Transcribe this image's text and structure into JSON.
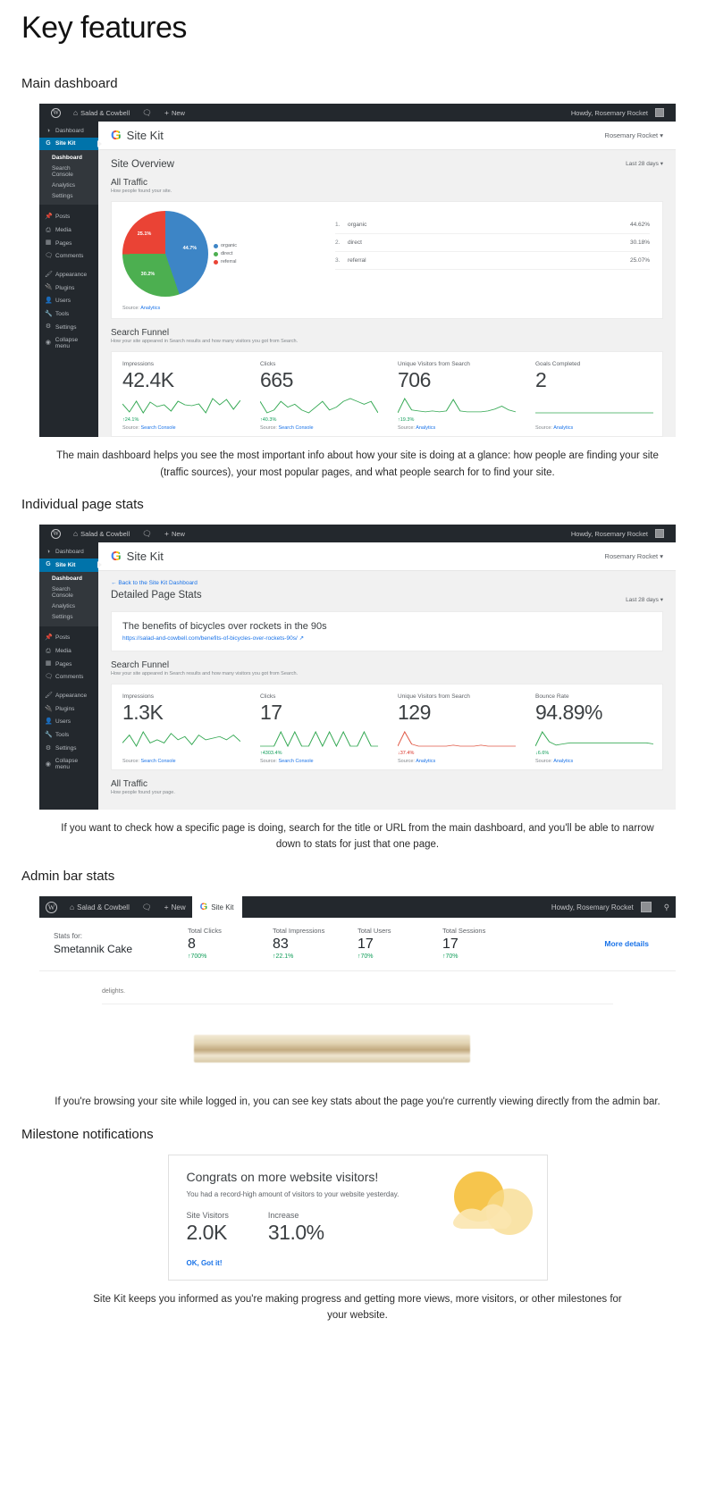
{
  "page": {
    "title": "Key features"
  },
  "sections": [
    {
      "heading": "Main dashboard"
    },
    {
      "heading": "Individual page stats"
    },
    {
      "heading": "Admin bar stats"
    },
    {
      "heading": "Milestone notifications"
    }
  ],
  "captions": {
    "main_dashboard": "The main dashboard helps you see the most important info about how your site is doing at a glance: how people are finding your site (traffic sources), your most popular pages, and what people search for to find your site.",
    "page_stats": "If you want to check how a specific page is doing, search for the title or URL from the main dashboard, and you'll be able to narrow down to stats for just that one page.",
    "admin_bar": "If you're browsing your site while logged in, you can see key stats about the page you're currently viewing directly from the admin bar.",
    "milestone": "Site Kit keeps you informed as you're making progress and getting more views, more visitors, or other milestones for your website."
  },
  "adminbar": {
    "wp_logo": "wordpress-logo-icon",
    "site_name": "Salad & Cowbell",
    "comments_icon": "comments-icon",
    "new_label": "New",
    "howdy": "Howdy, Rosemary Rocket",
    "avatar": "avatar",
    "sitekit_tab": "Site Kit",
    "search_icon": "search-icon"
  },
  "wp_menu": {
    "dashboard": "Dashboard",
    "site_kit": "Site Kit",
    "sitekit_submenu": [
      "Dashboard",
      "Search Console",
      "Analytics",
      "Settings"
    ],
    "items": [
      {
        "label": "Posts",
        "icon": "pin-icon"
      },
      {
        "label": "Media",
        "icon": "media-icon"
      },
      {
        "label": "Pages",
        "icon": "page-icon"
      },
      {
        "label": "Comments",
        "icon": "comment-icon"
      }
    ],
    "items2": [
      {
        "label": "Appearance",
        "icon": "brush-icon"
      },
      {
        "label": "Plugins",
        "icon": "plugin-icon"
      },
      {
        "label": "Users",
        "icon": "users-icon"
      },
      {
        "label": "Tools",
        "icon": "tools-icon"
      },
      {
        "label": "Settings",
        "icon": "settings-icon"
      }
    ],
    "collapse": "Collapse menu"
  },
  "sitekit": {
    "brand": "Site Kit",
    "g_logo": "google-g-icon",
    "user": "Rosemary Rocket",
    "user_chevron": "chevron-down-icon"
  },
  "dashboard": {
    "overview_title": "Site Overview",
    "date_range": "Last 28 days",
    "date_range_chevron": "chevron-down-icon",
    "all_traffic": {
      "title": "All Traffic",
      "subtitle": "How people found your site.",
      "source_label": "Source:",
      "source_link": "Analytics"
    },
    "search_funnel": {
      "title": "Search Funnel",
      "subtitle": "How your site appeared in Search results and how many visitors you got from Search.",
      "cells": [
        {
          "label": "Impressions",
          "value": "42.4K",
          "change": "24.1%",
          "direction": "up",
          "source_label": "Source:",
          "source_link": "Search Console",
          "spark": [
            14,
            5,
            17,
            4,
            16,
            11,
            13,
            6,
            17,
            13,
            12,
            14,
            4,
            20,
            13,
            19,
            8,
            18
          ]
        },
        {
          "label": "Clicks",
          "value": "665",
          "change": "40.3%",
          "direction": "up",
          "source_label": "Source:",
          "source_link": "Search Console",
          "spark": [
            13,
            9,
            10,
            13,
            11,
            12,
            10,
            9,
            11,
            13,
            10,
            11,
            13,
            14,
            13,
            12,
            13,
            9
          ]
        },
        {
          "label": "Unique Visitors from Search",
          "value": "706",
          "change": "19.3%",
          "direction": "up",
          "source_label": "Source:",
          "source_link": "Analytics",
          "spark": [
            4,
            19,
            7,
            6,
            5,
            6,
            5,
            6,
            18,
            6,
            5,
            5,
            5,
            6,
            8,
            11,
            7,
            5
          ]
        },
        {
          "label": "Goals Completed",
          "value": "2",
          "change": "",
          "direction": "flat",
          "source_label": "Source:",
          "source_link": "Analytics",
          "spark": [
            10,
            10,
            10,
            10,
            10,
            10,
            10,
            10,
            10,
            10,
            10,
            10,
            10,
            10,
            10,
            10,
            10,
            10
          ]
        }
      ]
    }
  },
  "page_stats": {
    "back_link": "Back to the Site Kit Dashboard",
    "back_arrow": "arrow-left-icon",
    "title": "Detailed Page Stats",
    "date_range": "Last 28 days",
    "page_title": "The benefits of bicycles over rockets in the 90s",
    "page_url": "https://salad-and-cowbell.com/benefits-of-bicycles-over-rockets-90s/",
    "external_icon": "external-link-icon",
    "search_funnel": {
      "title": "Search Funnel",
      "subtitle": "How your site appeared in Search results and how many visitors you got from Search.",
      "cells": [
        {
          "label": "Impressions",
          "value": "1.3K",
          "change": "",
          "direction": "flat",
          "source_label": "Source:",
          "source_link": "Search Console",
          "spark": [
            9,
            14,
            7,
            16,
            9,
            11,
            9,
            15,
            11,
            13,
            8,
            14,
            11,
            12,
            13,
            11,
            14,
            10
          ]
        },
        {
          "label": "Clicks",
          "value": "17",
          "change": "4303.4%",
          "direction": "up",
          "source_label": "Source:",
          "source_link": "Search Console",
          "spark": [
            11,
            11,
            11,
            12,
            11,
            12,
            11,
            11,
            12,
            11,
            12,
            11,
            12,
            11,
            11,
            12,
            11,
            11
          ]
        },
        {
          "label": "Unique Visitors from Search",
          "value": "129",
          "change": "37.4%",
          "direction": "down",
          "source_label": "Source:",
          "source_link": "Analytics",
          "spark": [
            5,
            19,
            7,
            5,
            5,
            5,
            5,
            5,
            6,
            5,
            5,
            5,
            6,
            5,
            5,
            5,
            5,
            5
          ]
        },
        {
          "label": "Bounce Rate",
          "value": "94.89%",
          "change": "6.6%",
          "direction": "down-green",
          "source_label": "Source:",
          "source_link": "Analytics",
          "spark": [
            5,
            18,
            9,
            6,
            7,
            8,
            8,
            8,
            8,
            8,
            8,
            8,
            8,
            8,
            8,
            8,
            8,
            7
          ]
        }
      ]
    },
    "all_traffic": {
      "title": "All Traffic",
      "subtitle": "How people found your page."
    }
  },
  "admin_bar_stats": {
    "stats_for_label": "Stats for:",
    "page_name": "Smetannik Cake",
    "stats": [
      {
        "label": "Total Clicks",
        "value": "8",
        "change": "700%"
      },
      {
        "label": "Total Impressions",
        "value": "83",
        "change": "22.1%"
      },
      {
        "label": "Total Users",
        "value": "17",
        "change": "70%"
      },
      {
        "label": "Total Sessions",
        "value": "17",
        "change": "70%"
      }
    ],
    "more_details": "More details",
    "body_text_tail": "delights.",
    "image_alt": "smetannik-cake-photo"
  },
  "milestone": {
    "title": "Congrats on more website visitors!",
    "subtitle": "You had a record-high amount of visitors to your website yesterday.",
    "stats": [
      {
        "label": "Site Visitors",
        "value": "2.0K"
      },
      {
        "label": "Increase",
        "value": "31.0%"
      }
    ],
    "cta": "OK, Got it!",
    "illustration": "sun-clouds-illustration"
  },
  "chart_data": {
    "type": "pie",
    "title": "All Traffic",
    "subtitle": "How people found your site.",
    "labels": [
      "organic",
      "direct",
      "referral"
    ],
    "values": [
      44.7,
      30.2,
      25.1
    ],
    "slice_labels": [
      "44.7%",
      "30.2%",
      "25.1%"
    ],
    "colors": [
      "#3d85c6",
      "#4caf50",
      "#ea4335"
    ],
    "legend_position": "right",
    "ranked_list": [
      {
        "rank": "1.",
        "name": "organic",
        "percent": "44.62%",
        "color": "#3d85c6"
      },
      {
        "rank": "2.",
        "name": "direct",
        "percent": "30.18%",
        "color": "#4caf50"
      },
      {
        "rank": "3.",
        "name": "referral",
        "percent": "25.07%",
        "color": "#ea4335"
      }
    ]
  }
}
